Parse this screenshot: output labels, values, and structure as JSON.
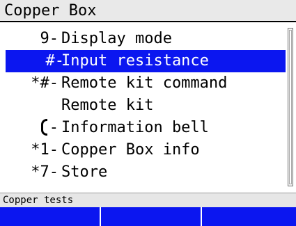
{
  "window": {
    "title": "Copper Box"
  },
  "menu": {
    "items": [
      {
        "key": "9-",
        "label": "Display mode",
        "selected": false,
        "icon": ""
      },
      {
        "key": "#-",
        "label": "Input resistance",
        "selected": true,
        "icon": ""
      },
      {
        "key": "*#-",
        "label": "Remote kit command",
        "selected": false,
        "icon": ""
      },
      {
        "key": "",
        "label": "Remote kit",
        "selected": false,
        "icon": ""
      },
      {
        "key": "-",
        "label": "Information bell",
        "selected": false,
        "icon": "bell-icon"
      },
      {
        "key": "*1-",
        "label": "Copper Box info",
        "selected": false,
        "icon": ""
      },
      {
        "key": "*7-",
        "label": "Store",
        "selected": false,
        "icon": ""
      }
    ]
  },
  "status": {
    "text": "Copper tests"
  },
  "softkeys": [
    "",
    "",
    ""
  ],
  "colors": {
    "selection": "#0b16f0",
    "softkey_bar": "#0b16f0",
    "titlebar": "#e9e9e9",
    "statusbar": "#e6e6e6"
  }
}
